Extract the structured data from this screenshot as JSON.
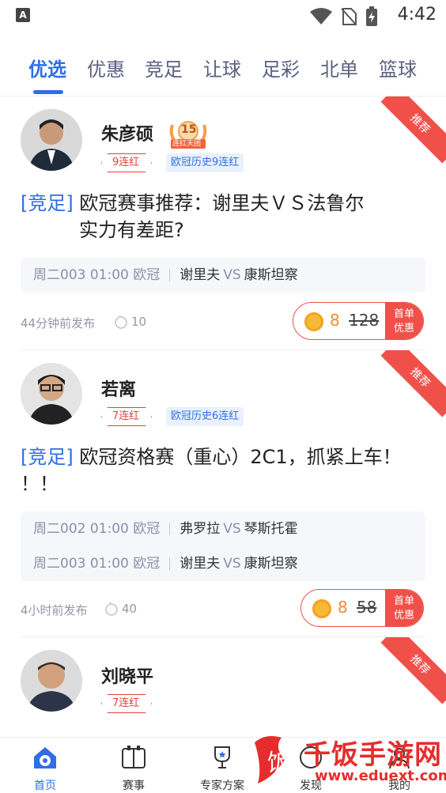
{
  "status_bar": {
    "time": "4:42",
    "app_indicator": "A"
  },
  "tabs": [
    {
      "label": "优选",
      "active": true
    },
    {
      "label": "优惠"
    },
    {
      "label": "竞足"
    },
    {
      "label": "让球"
    },
    {
      "label": "足彩"
    },
    {
      "label": "北单"
    },
    {
      "label": "篮球"
    }
  ],
  "cards": [
    {
      "name": "朱彦硕",
      "level_badge": "15",
      "level_badge_caption": "连红天团",
      "streak": "9连红",
      "history": "欧冠历史9连红",
      "ribbon": "推荐",
      "category": "[竞足]",
      "title_line1": "欧冠赛事推荐：谢里夫ＶＳ法鲁尔",
      "title_line2": "实力有差距?",
      "matches": [
        {
          "code": "周二003 01:00 欧冠",
          "home": "谢里夫",
          "vs": "VS",
          "away": "康斯坦察"
        }
      ],
      "published": "44分钟前发布",
      "views": "10",
      "price": "8",
      "old_price": "128",
      "first_badge": [
        "首单",
        "优惠"
      ]
    },
    {
      "name": "若离",
      "streak": "7连红",
      "history": "欧冠历史6连红",
      "ribbon": "推荐",
      "category": "[竞足]",
      "title_line1": "欧冠资格赛（重心）2C1，抓紧上车！",
      "title_line2": "！！",
      "matches": [
        {
          "code": "周二002 01:00 欧冠",
          "home": "弗罗拉",
          "vs": "VS",
          "away": "琴斯托霍"
        },
        {
          "code": "周二003 01:00 欧冠",
          "home": "谢里夫",
          "vs": "VS",
          "away": "康斯坦察"
        }
      ],
      "published": "4小时前发布",
      "views": "40",
      "price": "8",
      "old_price": "58",
      "first_badge": [
        "首单",
        "优惠"
      ]
    },
    {
      "name": "刘晓平",
      "streak": "7连红",
      "ribbon": "推荐"
    }
  ],
  "bottom_nav": [
    {
      "label": "首页",
      "icon": "home-ball-icon",
      "active": true
    },
    {
      "label": "赛事",
      "icon": "scoreboard-icon"
    },
    {
      "label": "专家方案",
      "icon": "trophy-icon"
    },
    {
      "label": "发现",
      "icon": "discover-icon"
    },
    {
      "label": "我的",
      "icon": "profile-icon"
    }
  ],
  "watermark": {
    "text": "千饭手游网",
    "url": "www.eduext.com",
    "logo_char": "饭"
  },
  "colors": {
    "accent": "#2f6ee4",
    "red": "#f0504a",
    "coin": "#f7b93a"
  }
}
